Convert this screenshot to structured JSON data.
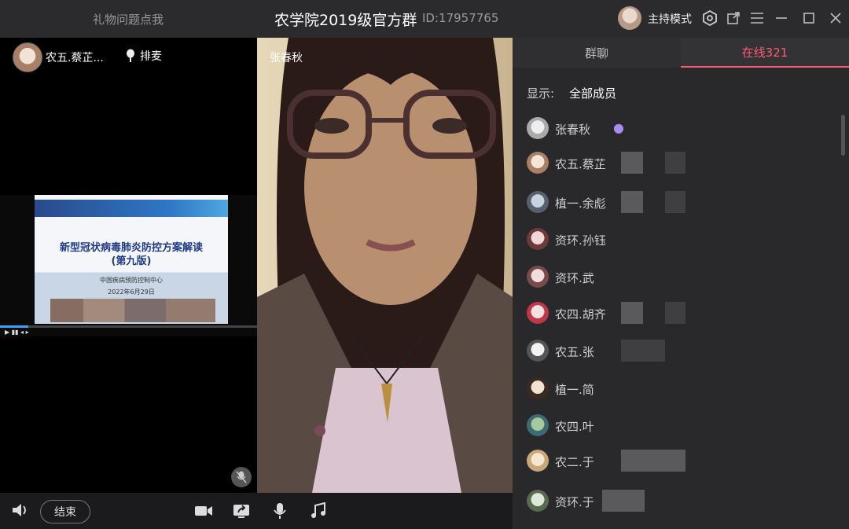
{
  "titlebar": {
    "left_link": "礼物问题点我",
    "title": "农学院2019级官方群",
    "id_text": "ID:17957765",
    "mode_label": "主持模式"
  },
  "left_panel": {
    "speaker_name": "农五.蔡芷...",
    "queue_label": "排麦",
    "slide": {
      "title_line1": "新型冠状病毒肺炎防控方案解读",
      "title_line2": "(第九版)",
      "org": "中国疾病预防控制中心",
      "date": "2022年6月29日"
    },
    "progress_fraction": 0.11
  },
  "video_panel": {
    "name": "张春秋"
  },
  "bottom_bar": {
    "end_label": "结束"
  },
  "right_panel": {
    "tabs": [
      {
        "label": "群聊"
      },
      {
        "label": "在线321"
      }
    ],
    "display_label": "显示:",
    "display_value": "全部成员",
    "members": [
      {
        "name": "张春秋"
      },
      {
        "name": "农五.蔡芷"
      },
      {
        "name": "植一.余彪"
      },
      {
        "name": "资环.孙钰"
      },
      {
        "name": "资环.武"
      },
      {
        "name": "农四.胡齐"
      },
      {
        "name": "农五.张"
      },
      {
        "name": "植一.简"
      },
      {
        "name": "农四.叶"
      },
      {
        "name": "农二.于"
      },
      {
        "name": "资环.于"
      }
    ]
  },
  "colors": {
    "accent": "#ff5a73",
    "panel_bg": "#29292b"
  }
}
